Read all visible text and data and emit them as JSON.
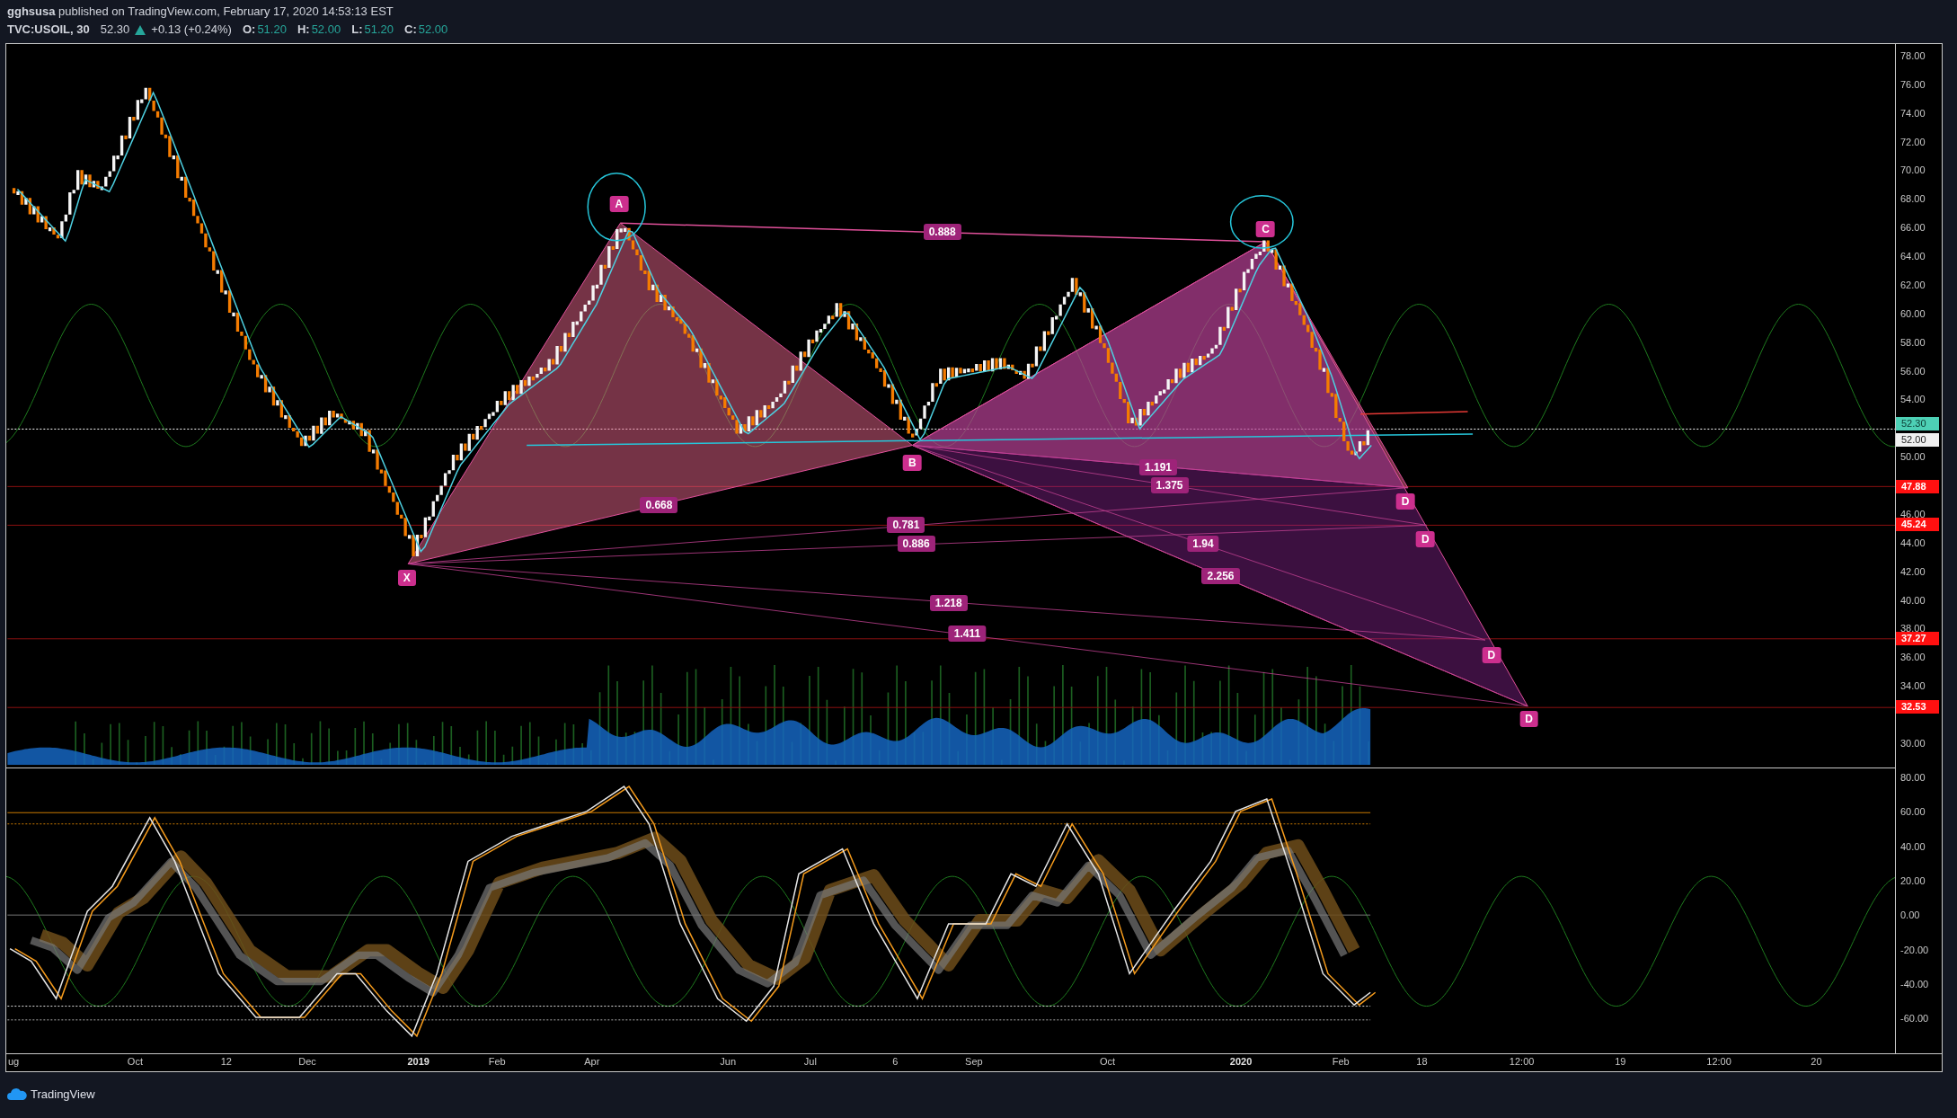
{
  "header": {
    "published": "**gghsusa** published on TradingView.com, February 17, 2020 14:53:13 EST",
    "symbol": "TVC:USOIL, 30",
    "last": "52.30",
    "change": "+0.13 (+0.24%)",
    "ohlc": [
      {
        "label": "O:",
        "value": "51.20"
      },
      {
        "label": "H:",
        "value": "52.00"
      },
      {
        "label": "L:",
        "value": "51.20"
      },
      {
        "label": "C:",
        "value": "52.00"
      }
    ]
  },
  "price_axis": {
    "labels": [
      "78.00",
      "76.00",
      "74.00",
      "72.00",
      "70.00",
      "68.00",
      "66.00",
      "64.00",
      "62.00",
      "60.00",
      "58.00",
      "56.00",
      "54.00",
      "50.00",
      "46.00",
      "44.00",
      "42.00",
      "40.00",
      "38.00",
      "36.00",
      "34.00",
      "30.00"
    ],
    "tags": [
      {
        "kind": "last",
        "text": "52.30"
      },
      {
        "kind": "close",
        "text": "52.00"
      },
      {
        "kind": "level",
        "text": "47.88"
      },
      {
        "kind": "level",
        "text": "45.24"
      },
      {
        "kind": "level",
        "text": "37.27"
      },
      {
        "kind": "level",
        "text": "32.53"
      }
    ]
  },
  "pattern_labels": [
    {
      "kind": "point",
      "text": "A"
    },
    {
      "kind": "point",
      "text": "C"
    },
    {
      "kind": "point",
      "text": "B"
    },
    {
      "kind": "point",
      "text": "X"
    },
    {
      "kind": "point",
      "text": "D"
    },
    {
      "kind": "point",
      "text": "D"
    },
    {
      "kind": "point",
      "text": "D"
    },
    {
      "kind": "point",
      "text": "D"
    },
    {
      "kind": "ratio",
      "text": "0.888"
    },
    {
      "kind": "ratio",
      "text": "0.668"
    },
    {
      "kind": "ratio",
      "text": "0.781"
    },
    {
      "kind": "ratio",
      "text": "0.886"
    },
    {
      "kind": "ratio",
      "text": "1.191"
    },
    {
      "kind": "ratio",
      "text": "1.375"
    },
    {
      "kind": "ratio",
      "text": "1.94"
    },
    {
      "kind": "ratio",
      "text": "2.256"
    },
    {
      "kind": "ratio",
      "text": "1.218"
    },
    {
      "kind": "ratio",
      "text": "1.411"
    }
  ],
  "indicator_axis": {
    "labels": [
      "80.00",
      "60.00",
      "40.00",
      "20.00",
      "0.00",
      "-20.00",
      "-40.00",
      "-60.00"
    ]
  },
  "time_axis": [
    {
      "kind": "month",
      "text": "ug"
    },
    {
      "kind": "month",
      "text": "Oct"
    },
    {
      "kind": "month",
      "text": "12"
    },
    {
      "kind": "month",
      "text": "Dec"
    },
    {
      "kind": "year",
      "text": "2019"
    },
    {
      "kind": "month",
      "text": "Feb"
    },
    {
      "kind": "month",
      "text": "Apr"
    },
    {
      "kind": "month",
      "text": "Jun"
    },
    {
      "kind": "month",
      "text": "Jul"
    },
    {
      "kind": "month",
      "text": "6"
    },
    {
      "kind": "month",
      "text": "Sep"
    },
    {
      "kind": "month",
      "text": "Oct"
    },
    {
      "kind": "year",
      "text": "2020"
    },
    {
      "kind": "month",
      "text": "Feb"
    },
    {
      "kind": "month",
      "text": "18"
    },
    {
      "kind": "month",
      "text": "12:00"
    },
    {
      "kind": "month",
      "text": "19"
    },
    {
      "kind": "month",
      "text": "12:00"
    },
    {
      "kind": "month",
      "text": "20"
    }
  ],
  "footer": {
    "brand": "TradingView"
  }
}
